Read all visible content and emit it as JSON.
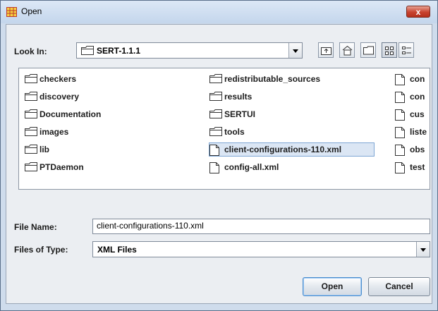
{
  "window": {
    "title": "Open",
    "close_label": "x"
  },
  "look_in": {
    "label": "Look In:",
    "value": "SERT-1.1.1"
  },
  "toolbar": {
    "icons": [
      "up-one-level-icon",
      "home-icon",
      "new-folder-icon",
      "list-view-icon",
      "details-view-icon"
    ]
  },
  "files": {
    "column1": [
      "checkers",
      "discovery",
      "Documentation",
      "images",
      "lib",
      "PTDaemon"
    ],
    "column2": [
      "redistributable_sources",
      "results",
      "SERTUI",
      "tools",
      "client-configurations-110.xml",
      "config-all.xml"
    ],
    "column3": [
      "con",
      "con",
      "cus",
      "liste",
      "obs",
      "test"
    ],
    "column2_types": [
      "folder",
      "folder",
      "folder",
      "folder",
      "file",
      "file"
    ],
    "selected": "client-configurations-110.xml"
  },
  "file_name": {
    "label": "File Name:",
    "value": "client-configurations-110.xml"
  },
  "file_type": {
    "label": "Files of Type:",
    "value": "XML Files"
  },
  "buttons": {
    "open": "Open",
    "cancel": "Cancel"
  },
  "colors": {
    "selection_bg": "#dbe6f4",
    "selection_border": "#7ea6d4",
    "close_red": "#c8432f",
    "frame": "#cfdcec"
  }
}
